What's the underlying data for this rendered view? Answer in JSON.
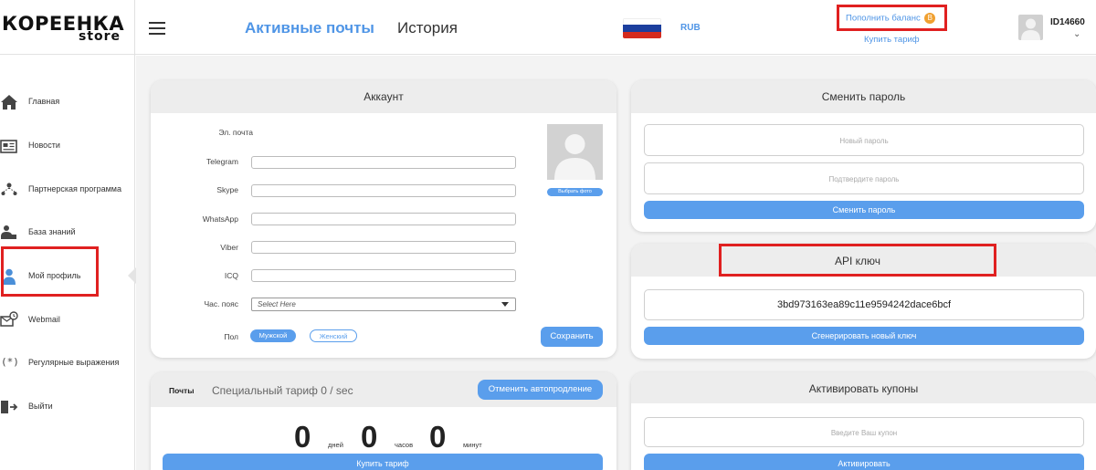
{
  "brand": {
    "logo_main": "КОРЕЕНКА",
    "logo_sub": "store"
  },
  "header": {
    "nav_active": "Активные почты",
    "nav_history": "История",
    "currency": "RUB",
    "topup_label": "Пополнить баланс",
    "coin_symbol": "B",
    "buy_tariff": "Купить тариф",
    "user_id": "ID14660",
    "user_chevron": "⌄",
    "flag_colors": [
      "#ffffff",
      "#1c3f9e",
      "#d52b1e"
    ]
  },
  "sidebar": {
    "items": [
      {
        "label": "Главная",
        "icon": "home-icon"
      },
      {
        "label": "Новости",
        "icon": "news-icon"
      },
      {
        "label": "Партнерская программа",
        "icon": "partner-icon"
      },
      {
        "label": "База знаний",
        "icon": "knowledge-icon"
      },
      {
        "label": "Мой профиль",
        "icon": "profile-icon"
      },
      {
        "label": "Webmail",
        "icon": "webmail-icon"
      },
      {
        "label": "Регулярные выражения",
        "icon": "regex-icon",
        "glyph": "(*)"
      },
      {
        "label": "Выйти",
        "icon": "logout-icon"
      }
    ],
    "active": "Мой профиль"
  },
  "account": {
    "title": "Аккаунт",
    "email_label": "Эл. почта",
    "telegram_label": "Telegram",
    "skype_label": "Skype",
    "whatsapp_label": "WhatsApp",
    "viber_label": "Viber",
    "icq_label": "ICQ",
    "timezone_label": "Час. пояс",
    "timezone_value": "Select Here",
    "gender_label": "Пол",
    "gender_male": "Мужской",
    "gender_female": "Женский",
    "choose_photo": "Выбрать фото",
    "save": "Сохранить"
  },
  "mail_tariff": {
    "tab_label": "Почты",
    "tariff_text": "Специальный тариф 0 / sec",
    "cancel_renew": "Отменить автопродление",
    "days_value": "0",
    "days_label": "дней",
    "hours_value": "0",
    "hours_label": "часов",
    "minutes_value": "0",
    "minutes_label": "минут",
    "buy_button": "Купить тариф"
  },
  "change_password": {
    "title": "Сменить пароль",
    "new_placeholder": "Новый пароль",
    "confirm_placeholder": "Подтвердите пароль",
    "button": "Сменить пароль"
  },
  "api_key": {
    "title": "API ключ",
    "key_value": "3bd973163ea89c11e9594242dace6bcf",
    "button": "Сгенерировать новый ключ"
  },
  "coupons": {
    "title": "Активировать купоны",
    "placeholder": "Введите Ваш купон",
    "button": "Активировать"
  },
  "colors": {
    "accent": "#5a9eec",
    "highlight": "#e02020"
  }
}
